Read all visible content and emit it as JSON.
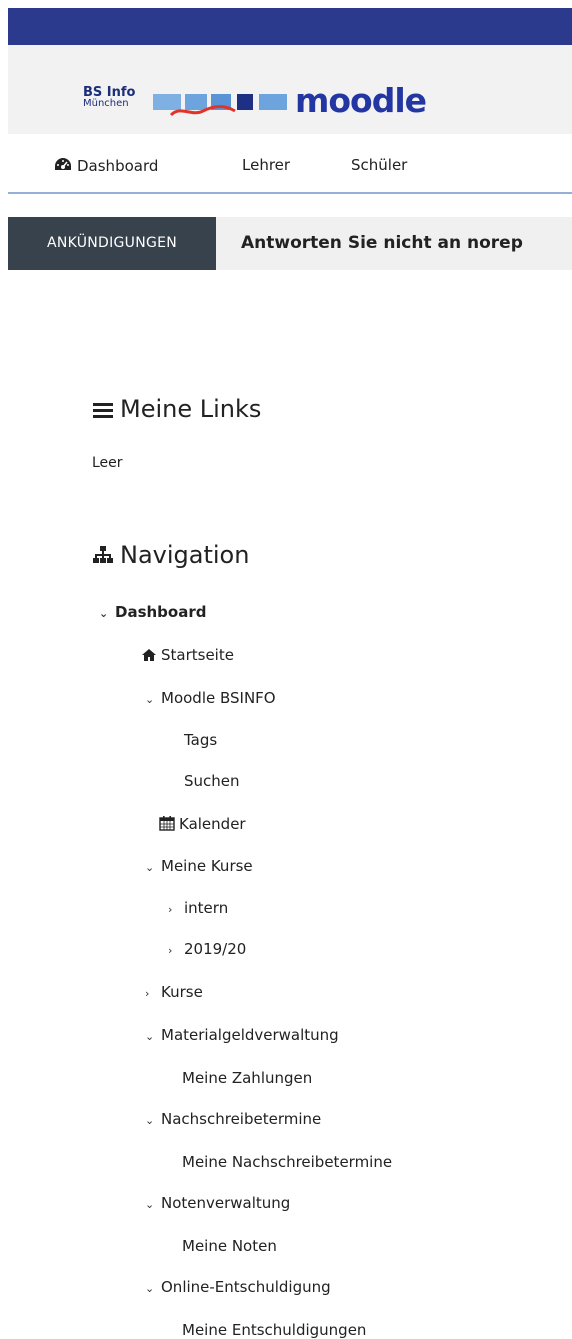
{
  "header": {
    "logo_line1": "BS Info",
    "logo_line2": "München",
    "logo_word": "moodle",
    "brand_color": "#2b3a8c"
  },
  "nav": {
    "dashboard": "Dashboard",
    "lehrer": "Lehrer",
    "schueler": "Schüler"
  },
  "announcement": {
    "label": "ANKÜNDIGUNGEN",
    "message": "Antworten Sie nicht an norep"
  },
  "blocks": {
    "links_title": "Meine Links",
    "links_empty": "Leer",
    "nav_title": "Navigation"
  },
  "tree": {
    "dashboard": "Dashboard",
    "startseite": "Startseite",
    "moodle": "Moodle BSINFO",
    "tags": "Tags",
    "suchen": "Suchen",
    "kalender": "Kalender",
    "meine_kurse": "Meine Kurse",
    "intern": "intern",
    "y2019": "2019/20",
    "kurse": "Kurse",
    "materialgeld": "Materialgeldverwaltung",
    "zahlungen": "Meine Zahlungen",
    "nachschreib": "Nachschreibetermine",
    "meine_nachschreib": "Meine Nachschreibetermine",
    "noten": "Notenverwaltung",
    "meine_noten": "Meine Noten",
    "entschuld": "Online-Entschuldigung",
    "meine_entschuld": "Meine Entschuldigungen"
  },
  "icons": {
    "dashboard": "dashboard-icon",
    "home": "home-icon",
    "calendar": "calendar-icon",
    "menu": "hamburger-icon",
    "sitemap": "sitemap-icon"
  }
}
